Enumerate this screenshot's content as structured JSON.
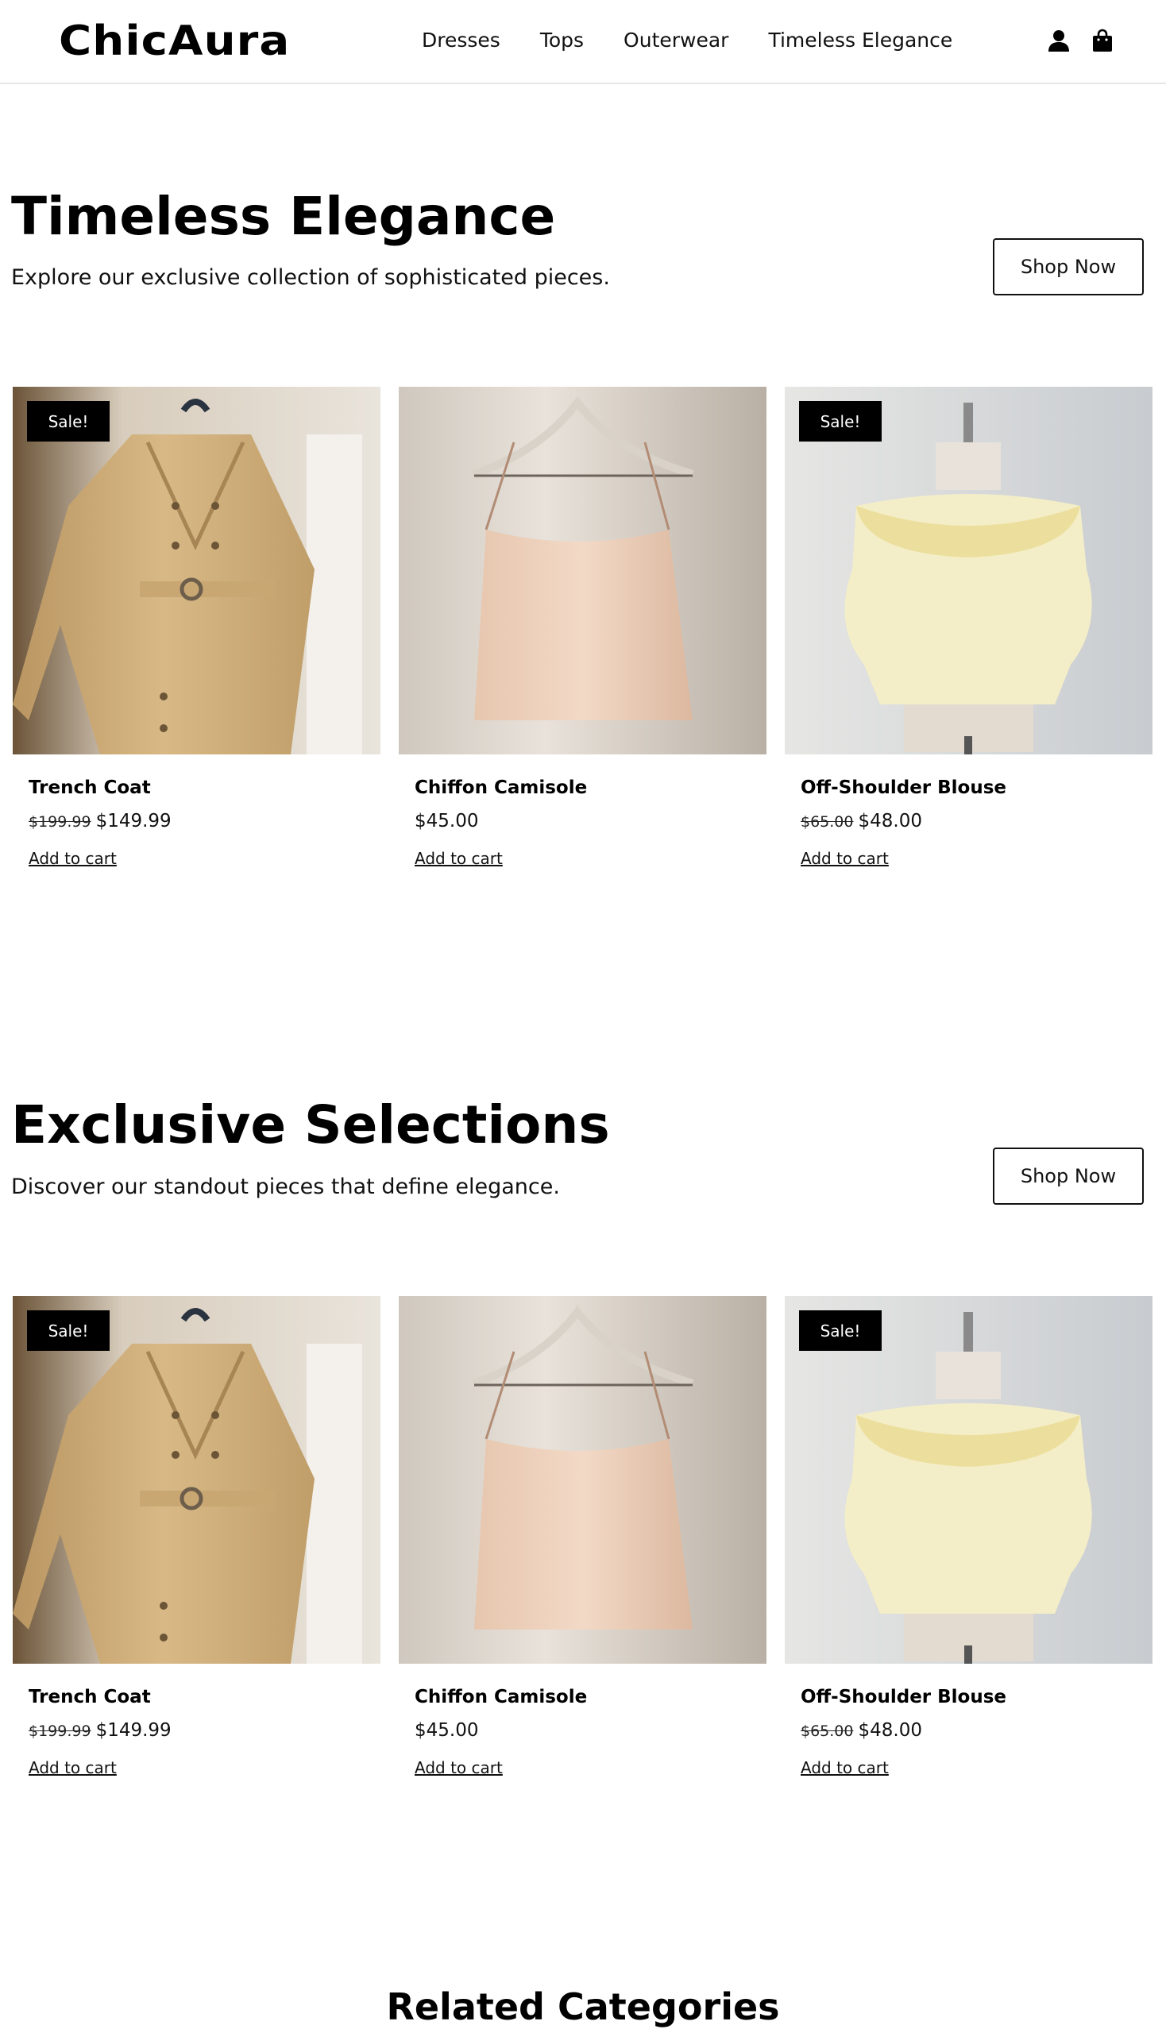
{
  "header": {
    "logo": "ChicAura",
    "nav": [
      "Dresses",
      "Tops",
      "Outerwear",
      "Timeless Elegance"
    ],
    "icons": [
      "user-icon",
      "shopping-bag-icon"
    ]
  },
  "sections": [
    {
      "title": "Timeless Elegance",
      "subtitle": "Explore our exclusive collection of sophisticated pieces.",
      "button": "Shop Now",
      "products": [
        {
          "name": "Trench Coat",
          "old_price": "$199.99",
          "price": "$149.99",
          "badge": "Sale!",
          "cart": "Add to cart"
        },
        {
          "name": "Chiffon Camisole",
          "old_price": "",
          "price": "$45.00",
          "badge": "",
          "cart": "Add to cart"
        },
        {
          "name": "Off-Shoulder Blouse",
          "old_price": "$65.00",
          "price": "$48.00",
          "badge": "Sale!",
          "cart": "Add to cart"
        }
      ]
    },
    {
      "title": "Exclusive Selections",
      "subtitle": "Discover our standout pieces that define elegance.",
      "button": "Shop Now",
      "products": [
        {
          "name": "Trench Coat",
          "old_price": "$199.99",
          "price": "$149.99",
          "badge": "Sale!",
          "cart": "Add to cart"
        },
        {
          "name": "Chiffon Camisole",
          "old_price": "",
          "price": "$45.00",
          "badge": "",
          "cart": "Add to cart"
        },
        {
          "name": "Off-Shoulder Blouse",
          "old_price": "$65.00",
          "price": "$48.00",
          "badge": "Sale!",
          "cart": "Add to cart"
        }
      ]
    }
  ],
  "related": {
    "title": "Related Categories"
  }
}
